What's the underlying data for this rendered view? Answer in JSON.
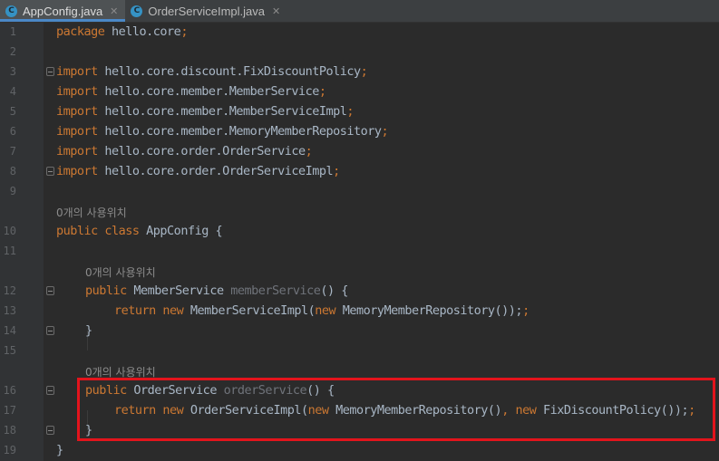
{
  "tabs": [
    {
      "label": "AppConfig.java",
      "active": true,
      "icon": "java-class-icon"
    },
    {
      "label": "OrderServiceImpl.java",
      "active": false,
      "icon": "java-class-icon"
    }
  ],
  "usage_hint": "0개의 사용위치",
  "code": {
    "l1": [
      "package",
      " hello.core",
      ";"
    ],
    "l3": [
      "import",
      " hello.core.discount.FixDiscountPolicy",
      ";"
    ],
    "l4": [
      "import",
      " hello.core.member.MemberService",
      ";"
    ],
    "l5": [
      "import",
      " hello.core.member.MemberServiceImpl",
      ";"
    ],
    "l6": [
      "import",
      " hello.core.member.MemoryMemberRepository",
      ";"
    ],
    "l7": [
      "import",
      " hello.core.order.OrderService",
      ";"
    ],
    "l8": [
      "import",
      " hello.core.order.OrderServiceImpl",
      ";"
    ],
    "l10": [
      "public class",
      " AppConfig",
      " {"
    ],
    "l12": [
      "public",
      " MemberService ",
      "memberService",
      "() {"
    ],
    "l13": [
      "return new",
      " MemberServiceImpl(",
      "new",
      " MemoryMemberRepository());"
    ],
    "l14": [
      "}"
    ],
    "l16": [
      "public",
      " OrderService ",
      "orderService",
      "() {"
    ],
    "l17": [
      "return new",
      " OrderServiceImpl(",
      "new",
      " MemoryMemberRepository()",
      ",",
      " new",
      " FixDiscountPolicy());"
    ],
    "l18": [
      "}"
    ],
    "l19": [
      "}"
    ]
  },
  "line_numbers": [
    "1",
    "2",
    "3",
    "4",
    "5",
    "6",
    "7",
    "8",
    "9",
    "10",
    "11",
    "12",
    "13",
    "14",
    "15",
    "16",
    "17",
    "18",
    "19"
  ],
  "colors": {
    "background": "#2b2b2b",
    "keyword": "#cc7832",
    "text": "#a9b7c6",
    "unused_method": "#6f737a",
    "highlight_box": "#e3141c"
  }
}
